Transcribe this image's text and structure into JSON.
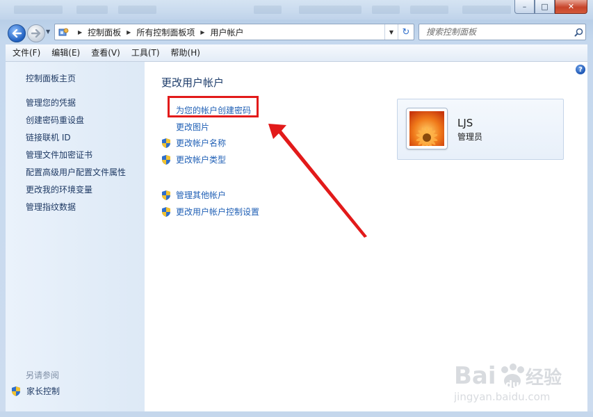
{
  "window": {
    "controls": {
      "minimize": "–",
      "maximize": "□",
      "close": "✕"
    },
    "accent_color": "#1f5fb5",
    "highlight_color": "#e21a1a"
  },
  "navigation": {
    "back_icon": "back-arrow-icon",
    "forward_icon": "forward-arrow-icon",
    "breadcrumbs": [
      "控制面板",
      "所有控制面板项",
      "用户帐户"
    ],
    "search_placeholder": "搜索控制面板"
  },
  "menubar": {
    "items": [
      "文件(F)",
      "编辑(E)",
      "查看(V)",
      "工具(T)",
      "帮助(H)"
    ]
  },
  "sidebar": {
    "home": "控制面板主页",
    "links": [
      "管理您的凭据",
      "创建密码重设盘",
      "链接联机 ID",
      "管理文件加密证书",
      "配置高级用户配置文件属性",
      "更改我的环境变量",
      "管理指纹数据"
    ],
    "see_also": "另请参阅",
    "parental_controls": "家长控制"
  },
  "main": {
    "title": "更改用户帐户",
    "tasks": [
      "为您的帐户创建密码",
      "更改图片",
      "更改帐户名称",
      "更改帐户类型"
    ],
    "other_tasks": [
      "管理其他帐户",
      "更改用户帐户控制设置"
    ],
    "help_icon": "?"
  },
  "user": {
    "name": "LJS",
    "role": "管理员",
    "avatar_icon": "flower-avatar-icon"
  },
  "watermark": {
    "brand": "Bai",
    "brand_mid": "du",
    "site_cn": "经验",
    "url": "jingyan.baidu.com"
  }
}
